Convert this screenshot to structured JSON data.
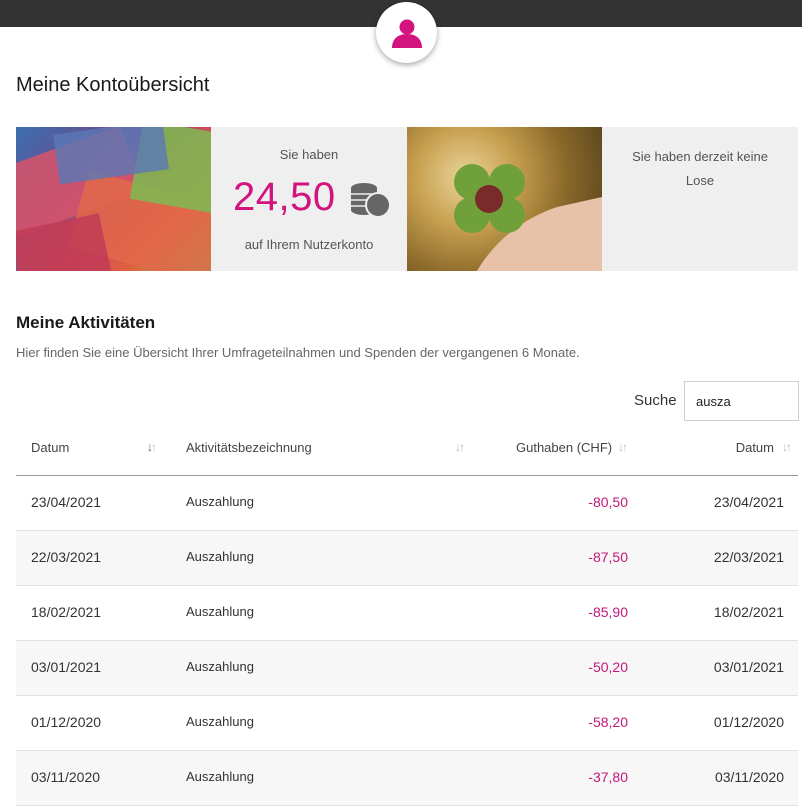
{
  "header": {
    "avatar_icon": "user-icon",
    "accent_color": "#d4147e"
  },
  "page_title": "Meine Kontoübersicht",
  "balance_card": {
    "intro": "Sie haben",
    "amount": "24,50",
    "icon": "coins-icon",
    "outro": "auf Ihrem Nutzerkonto"
  },
  "lottery_card": {
    "text": "Sie haben derzeit keine Lose"
  },
  "activities": {
    "title": "Meine Aktivitäten",
    "subtitle": "Hier finden Sie eine Übersicht Ihrer Umfrageteilnahmen und Spenden der vergangenen 6 Monate."
  },
  "search": {
    "label": "Suche",
    "value": "ausza"
  },
  "table": {
    "columns": [
      "Datum",
      "Aktivitätsbezeichnung",
      "Guthaben (CHF)",
      "Datum"
    ],
    "rows": [
      {
        "date": "23/04/2021",
        "name": "Auszahlung",
        "amount": "-80,50",
        "date2": "23/04/2021"
      },
      {
        "date": "22/03/2021",
        "name": "Auszahlung",
        "amount": "-87,50",
        "date2": "22/03/2021"
      },
      {
        "date": "18/02/2021",
        "name": "Auszahlung",
        "amount": "-85,90",
        "date2": "18/02/2021"
      },
      {
        "date": "03/01/2021",
        "name": "Auszahlung",
        "amount": "-50,20",
        "date2": "03/01/2021"
      },
      {
        "date": "01/12/2020",
        "name": "Auszahlung",
        "amount": "-58,20",
        "date2": "01/12/2020"
      },
      {
        "date": "03/11/2020",
        "name": "Auszahlung",
        "amount": "-37,80",
        "date2": "03/11/2020"
      }
    ]
  }
}
